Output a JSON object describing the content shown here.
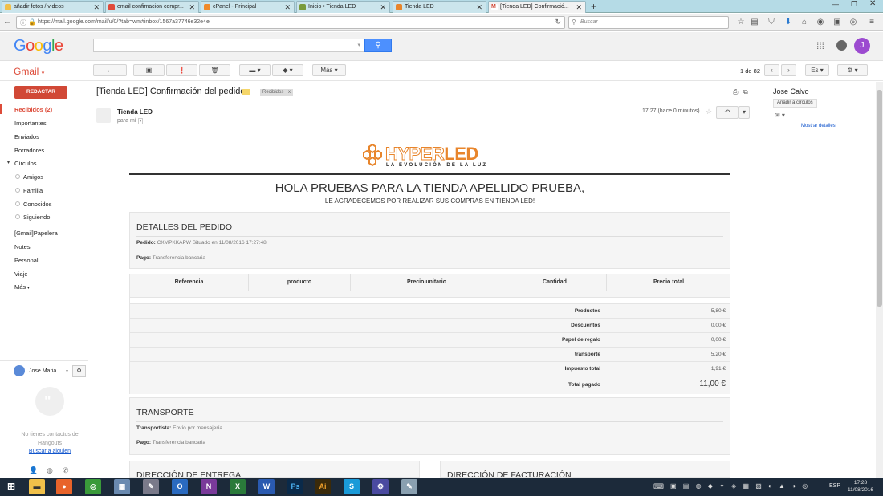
{
  "browser": {
    "tabs": [
      {
        "label": "añadir fotos / videos"
      },
      {
        "label": "email confimacion compr..."
      },
      {
        "label": "cPanel - Principal"
      },
      {
        "label": "Inicio • Tienda LED"
      },
      {
        "label": "Tienda LED"
      },
      {
        "label": "[Tienda LED] Confirmació..."
      }
    ],
    "url": "https://mail.google.com/mail/u/0/?tab=wm#inbox/1567a37746e32e4e",
    "search_placeholder": "Buscar"
  },
  "google": {
    "logo": "Google",
    "avatar_initial": "J"
  },
  "toolbar": {
    "gmail_label": "Gmail",
    "more_label": "Más",
    "page_count": "1 de 82",
    "lang": "Es"
  },
  "sidebar": {
    "compose": "REDACTAR",
    "items": [
      {
        "label": "Recibidos (2)"
      },
      {
        "label": "Importantes"
      },
      {
        "label": "Enviados"
      },
      {
        "label": "Borradores"
      },
      {
        "label": "Círculos"
      }
    ],
    "circles": [
      {
        "label": "Amigos"
      },
      {
        "label": "Familia"
      },
      {
        "label": "Conocidos"
      },
      {
        "label": "Siguiendo"
      }
    ],
    "labels": [
      {
        "label": "[Gmail]Papelera"
      },
      {
        "label": "Notes"
      },
      {
        "label": "Personal"
      },
      {
        "label": "Viaje"
      },
      {
        "label": "Más"
      }
    ],
    "hangouts_user": "Jose Maria",
    "hangouts_empty": "No tienes contactos de Hangouts",
    "hangouts_search": "Buscar a alguien"
  },
  "message": {
    "subject": "[Tienda LED] Confirmación del pedido",
    "label_chip": "Recibidos",
    "sender": "Tienda LED",
    "to": "para mí",
    "time": "17:27 (hace 0 minutos)"
  },
  "email": {
    "brand_hyper": "HYPER",
    "brand_led": "LED",
    "brand_tagline": "LA EVOLUCIÓN DE LA LUZ",
    "headline": "HOLA PRUEBAS PARA LA TIENDA APELLIDO PRUEBA,",
    "subheadline": "LE AGRADECEMOS POR REALIZAR SUS COMPRAS EN TIENDA LED!",
    "order_title": "DETALLES DEL PEDIDO",
    "order_label": "Pedido:",
    "order_value": "CXMPKKAPW Situado en 11/08/2016 17:27:48",
    "pay_label": "Pago:",
    "pay_value": "Transferencia bancaria",
    "table_headers": [
      "Referencia",
      "producto",
      "Precio unitario",
      "Cantidad",
      "Precio total"
    ],
    "totals": [
      {
        "label": "Productos",
        "value": "5,80 €"
      },
      {
        "label": "Descuentos",
        "value": "0,00 €"
      },
      {
        "label": "Papel de regalo",
        "value": "0,00 €"
      },
      {
        "label": "transporte",
        "value": "5,20 €"
      },
      {
        "label": "Impuesto total",
        "value": "1,91 €"
      },
      {
        "label": "Total pagado",
        "value": "11,00 €"
      }
    ],
    "transport_title": "TRANSPORTE",
    "carrier_label": "Transportista:",
    "carrier_value": "Envío por mensajería",
    "pay2_label": "Pago:",
    "pay2_value": "Transferencia bancaria",
    "delivery_title": "DIRECCIÓN DE ENTREGA",
    "billing_title": "DIRECCIÓN DE FACTURACIÓN"
  },
  "contact_panel": {
    "name": "Jose Calvo",
    "add_circles": "Añadir a círculos",
    "show_details": "Mostrar detalles"
  },
  "taskbar": {
    "lang": "ESP",
    "time": "17:28",
    "date": "11/08/2016"
  },
  "colors": {
    "gmail_red": "#dd4b39",
    "google_blue": "#4d90fe",
    "brand_orange": "#e8852b",
    "taskbar": "#1c2a3a"
  }
}
